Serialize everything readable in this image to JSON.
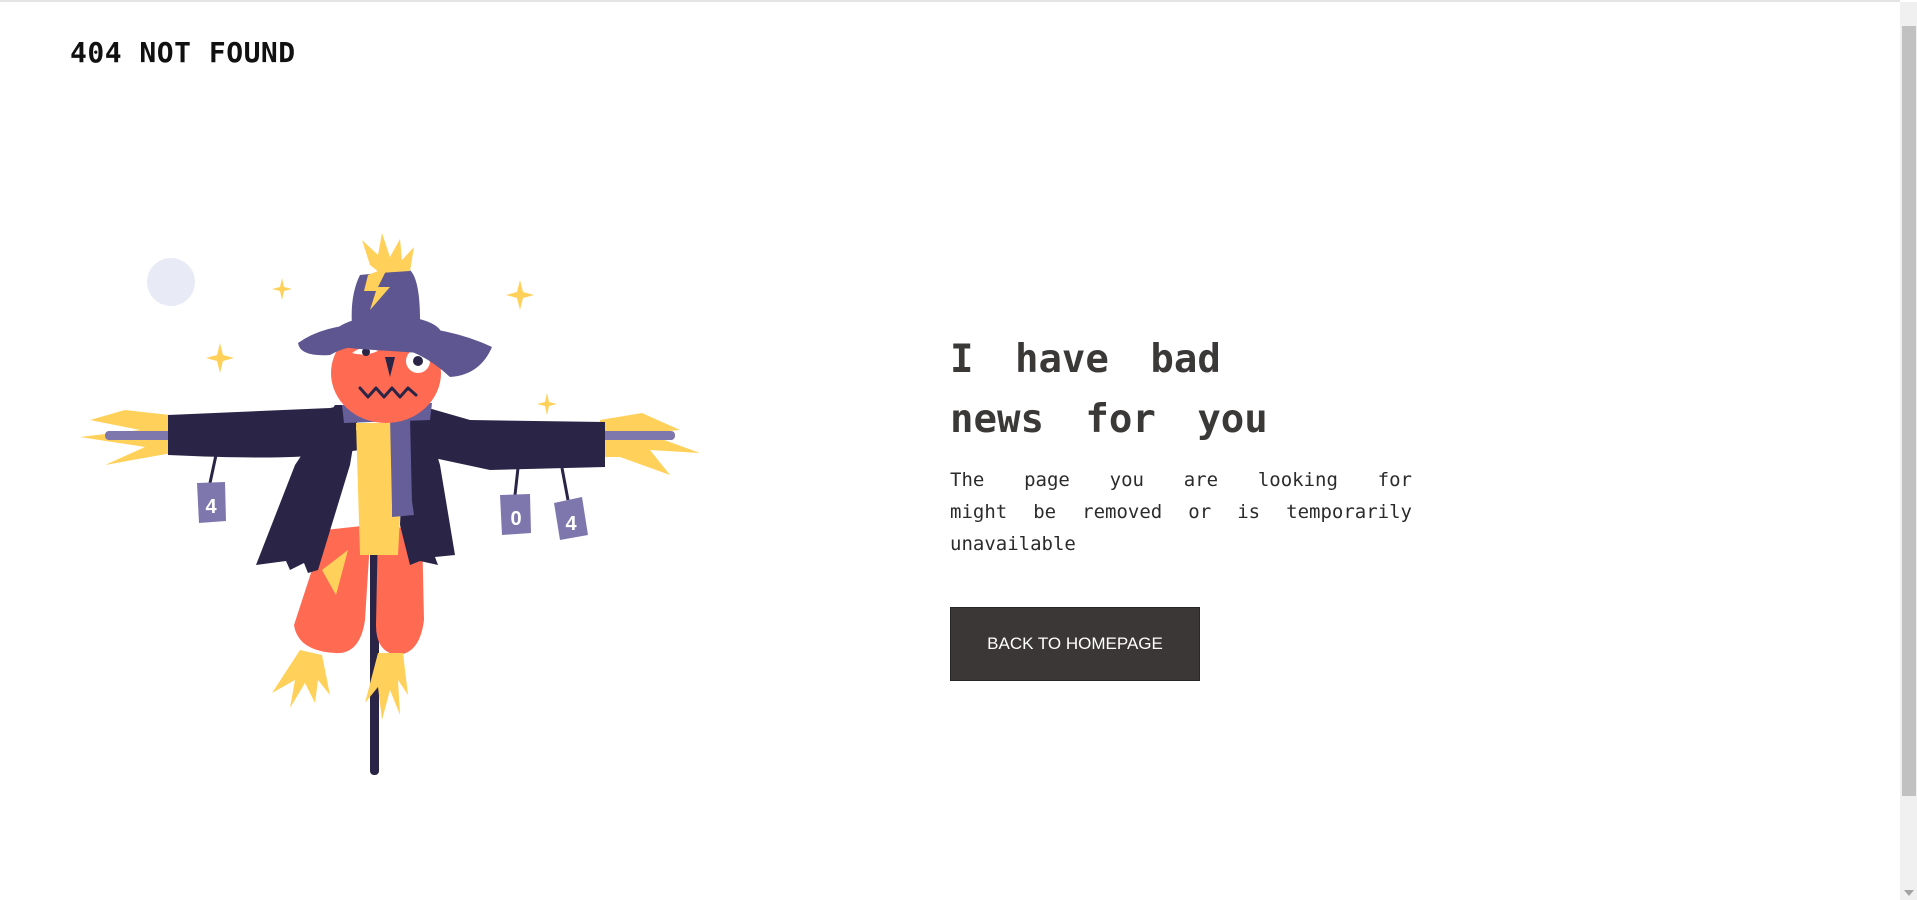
{
  "header": {
    "title": "404 NOT FOUND"
  },
  "main": {
    "headline": "I have bad news for you",
    "message": "The page you are looking for might be removed or is temporarily unavailable",
    "button_label": "BACK TO HOMEPAGE"
  },
  "illustration": {
    "subject": "scarecrow",
    "can_labels": [
      "4",
      "0",
      "4"
    ]
  },
  "colors": {
    "text_dark": "#3b3838",
    "button_bg": "#3b3736",
    "hat": "#5e5690",
    "coat": "#2a2546",
    "face": "#ff6a52",
    "straw": "#ffd15a",
    "scarf": "#665e99",
    "cans": "#7d77ad",
    "moon": "#e8ebf5"
  }
}
